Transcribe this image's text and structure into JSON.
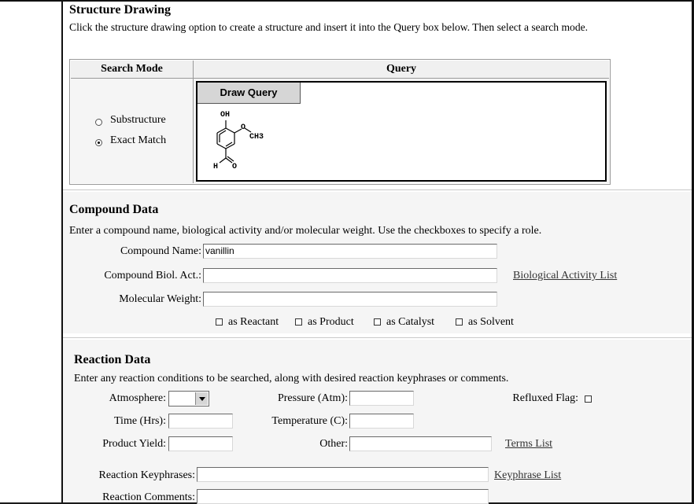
{
  "structure": {
    "title": "Structure Drawing",
    "description": "Click the structure drawing option to create a structure and insert it into the Query box below. Then select a search mode.",
    "col_search_mode": "Search Mode",
    "col_query": "Query",
    "mode_substructure": "Substructure",
    "mode_exact": "Exact Match",
    "selected_mode": "Exact Match",
    "draw_button": "Draw Query",
    "mol_oh": "OH",
    "mol_o": "O",
    "mol_ch3": "CH3",
    "mol_h": "H",
    "mol_o2": "O"
  },
  "compound": {
    "title": "Compound Data",
    "description": "Enter a compound name, biological activity and/or molecular weight. Use the checkboxes to specify a role.",
    "name_label": "Compound Name:",
    "name_value": "vanillin",
    "bioact_label": "Compound Biol. Act.:",
    "bioact_value": "",
    "bioact_link": "Biological Activity List",
    "mw_label": "Molecular Weight:",
    "mw_value": "",
    "role_reactant": "as Reactant",
    "role_product": "as Product",
    "role_catalyst": "as Catalyst",
    "role_solvent": "as Solvent"
  },
  "reaction": {
    "title": "Reaction Data",
    "description": "Enter any reaction conditions to be searched, along with desired reaction keyphrases or comments.",
    "atmosphere_label": "Atmosphere:",
    "atmosphere_value": "",
    "pressure_label": "Pressure (Atm):",
    "refluxed_label": "Refluxed Flag:",
    "time_label": "Time (Hrs):",
    "temperature_label": "Temperature (C):",
    "yield_label": "Product Yield:",
    "other_label": "Other:",
    "terms_link": "Terms List",
    "keyphrases_label": "Reaction Keyphrases:",
    "keyphrase_link": "Keyphrase List",
    "comments_label": "Reaction Comments:"
  }
}
